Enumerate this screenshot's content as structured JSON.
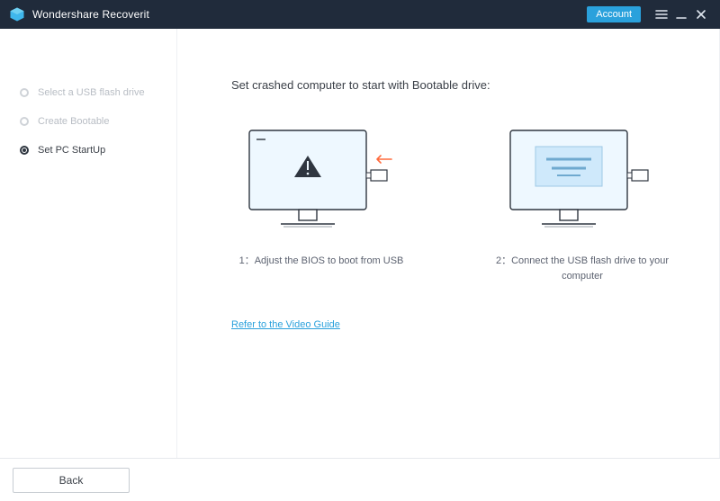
{
  "titlebar": {
    "app_name": "Wondershare Recoverit",
    "account_label": "Account"
  },
  "sidebar": {
    "steps": [
      {
        "label": "Select a USB flash drive",
        "active": false
      },
      {
        "label": "Create Bootable",
        "active": false
      },
      {
        "label": "Set PC StartUp",
        "active": true
      }
    ]
  },
  "main": {
    "heading": "Set crashed computer to start with Bootable drive:",
    "illustrations": [
      {
        "caption": "1：Adjust the BIOS to boot from USB"
      },
      {
        "caption": "2：Connect the USB flash drive to your computer"
      }
    ],
    "video_link": "Refer to the Video Guide"
  },
  "footer": {
    "back_label": "Back"
  }
}
